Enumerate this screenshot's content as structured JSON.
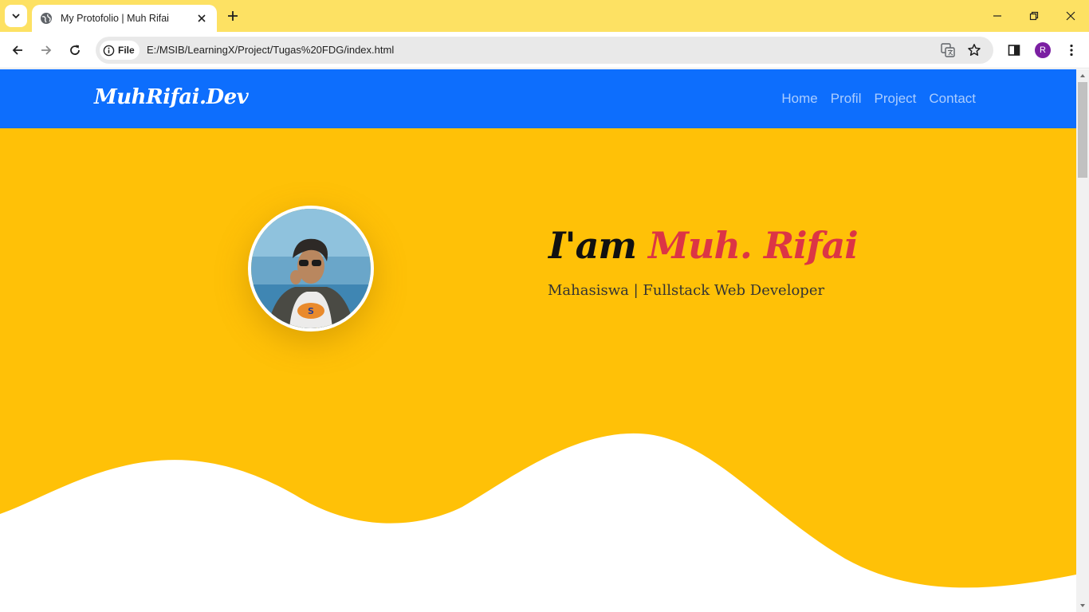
{
  "browser": {
    "tab_title": "My Protofolio | Muh Rifai",
    "site_chip": "File",
    "url": "E:/MSIB/LearningX/Project/Tugas%20FDG/index.html",
    "profile_initial": "R",
    "tabbar_color": "#fde163",
    "profile_color": "#7b1fa2"
  },
  "page": {
    "brand": "MuhRifai.Dev",
    "nav": [
      {
        "label": "Home"
      },
      {
        "label": "Profil"
      },
      {
        "label": "Project"
      },
      {
        "label": "Contact"
      }
    ],
    "hero": {
      "greeting": "I'am",
      "name": "Muh. Rifai",
      "tagline": "Mahasiswa | Fullstack Web Developer"
    },
    "colors": {
      "navbar": "#0d6efd",
      "hero_bg": "#ffc107",
      "name_accent": "#dc3545"
    }
  }
}
